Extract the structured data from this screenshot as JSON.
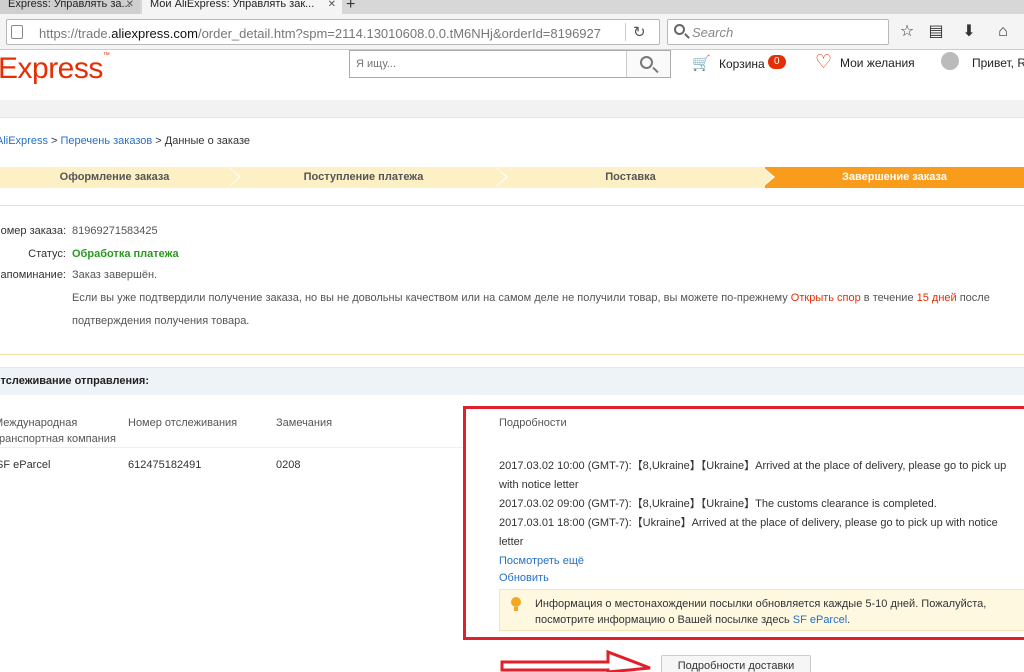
{
  "browser": {
    "tabs": [
      {
        "title": "Express: Управлять за..."
      },
      {
        "title": "Мои AliExpress: Управлять зак..."
      }
    ],
    "url_prefix": "https://trade.",
    "url_domain": "aliexpress.com",
    "url_rest": "/order_detail.htm?spm=2114.13010608.0.0.tM6NHj&orderId=8196927",
    "search_placeholder": "Search"
  },
  "site": {
    "logo": "Express",
    "logo_tm": "™",
    "search_placeholder": "Я ищу...",
    "cart_label": "Корзина",
    "cart_count": "0",
    "wishlist_label": "Мои желания",
    "greeting": "Привет, R"
  },
  "breadcrumb": {
    "home": "AliExpress",
    "sep1": " > ",
    "orders": "Перечень заказов",
    "sep2": " > ",
    "current": "Данные о заказе"
  },
  "steps": [
    {
      "label": "Оформление заказа"
    },
    {
      "label": "Поступление платежа"
    },
    {
      "label": "Поставка"
    },
    {
      "label": "Завершение заказа"
    }
  ],
  "order": {
    "number_label": "Номер заказа:",
    "number_value": "81969271583425",
    "status_label": "Статус:",
    "status_value": "Обработка платежа",
    "reminder_label": "Напоминание:",
    "reminder_value": "Заказ завершён.",
    "reminder_text_1": "Если вы уже подтвердили получение заказа, но вы не довольны качеством или на самом деле не получили товар, вы можете по-прежнему ",
    "dispute_link": "Открыть спор",
    "reminder_text_2": " в течение ",
    "days": "15 дней",
    "reminder_text_3": " после",
    "reminder_text_4": "подтверждения получения товара."
  },
  "tracking": {
    "heading": "Отслеживание отправления:",
    "col_company_1": "Международная",
    "col_company_2": "транспортная компания",
    "col_number": "Номер отслеживания",
    "col_remarks": "Замечания",
    "col_details": "Подробности",
    "company": "SF eParcel",
    "number": "612475182491",
    "remarks": "0208",
    "events": [
      "2017.03.02 10:00 (GMT-7):【8,Ukraine】【Ukraine】Arrived at the place of delivery, please go to pick up with notice letter",
      "2017.03.02 09:00 (GMT-7):【8,Ukraine】【Ukraine】The customs clearance is completed.",
      "2017.03.01 18:00 (GMT-7):【Ukraine】Arrived at the place of delivery, please go to pick up with notice letter"
    ],
    "see_more": "Посмотреть ещё",
    "refresh": "Обновить",
    "notice_1": "Информация о местонахождении посылки обновляется каждые 5-10 дней. Пожалуйста,",
    "notice_2": "посмотрите информацию о Вашей посылке здесь ",
    "notice_link": "SF eParcel",
    "notice_end": ".",
    "delivery_button": "Подробности доставки"
  },
  "colors": {
    "brand": "#e62e04",
    "step_active": "#f99c1c",
    "link": "#2670c5",
    "status_green": "#2a9a1f",
    "annotation_red": "#e0202a"
  }
}
